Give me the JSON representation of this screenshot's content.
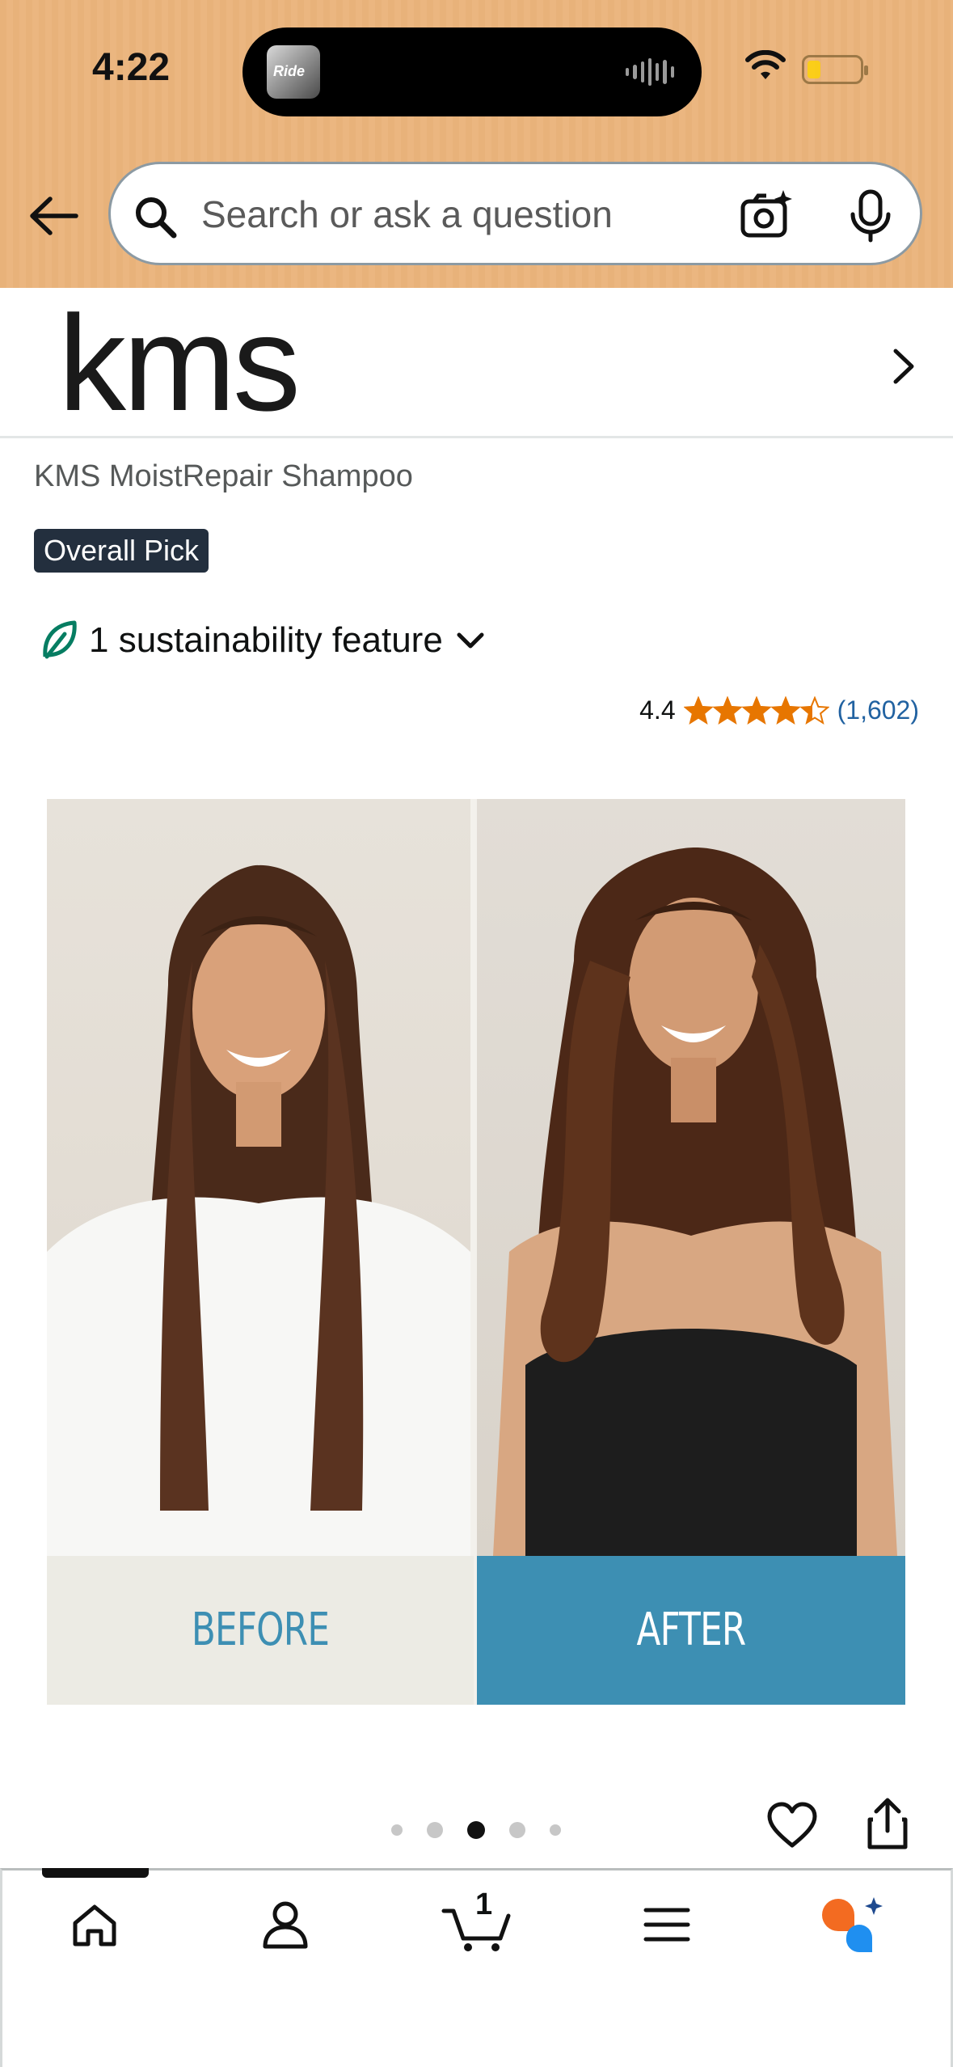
{
  "status_bar": {
    "time": "4:22",
    "now_playing_art_text": "Ride"
  },
  "search": {
    "placeholder": "Search or ask a question"
  },
  "brand": {
    "logo_text": "kms"
  },
  "product": {
    "title": "KMS MoistRepair Shampoo",
    "badge": "Overall Pick",
    "sustainability": "1 sustainability feature",
    "rating_value": "4.4",
    "rating_stars": 4.4,
    "review_count": "(1,602)"
  },
  "image": {
    "before_label": "BEFORE",
    "after_label": "AFTER",
    "carousel_count": 5,
    "carousel_active_index": 2
  },
  "bottom_nav": {
    "items": [
      "home-icon",
      "account-icon",
      "cart-icon",
      "menu-icon",
      "rufus-icon"
    ],
    "cart_count": "1"
  },
  "colors": {
    "header_bg": "#e8b27a",
    "badge_bg": "#232f3e",
    "star": "#e77600",
    "link": "#2162a1",
    "after_panel": "#3d8fb3",
    "leaf": "#067d62"
  }
}
